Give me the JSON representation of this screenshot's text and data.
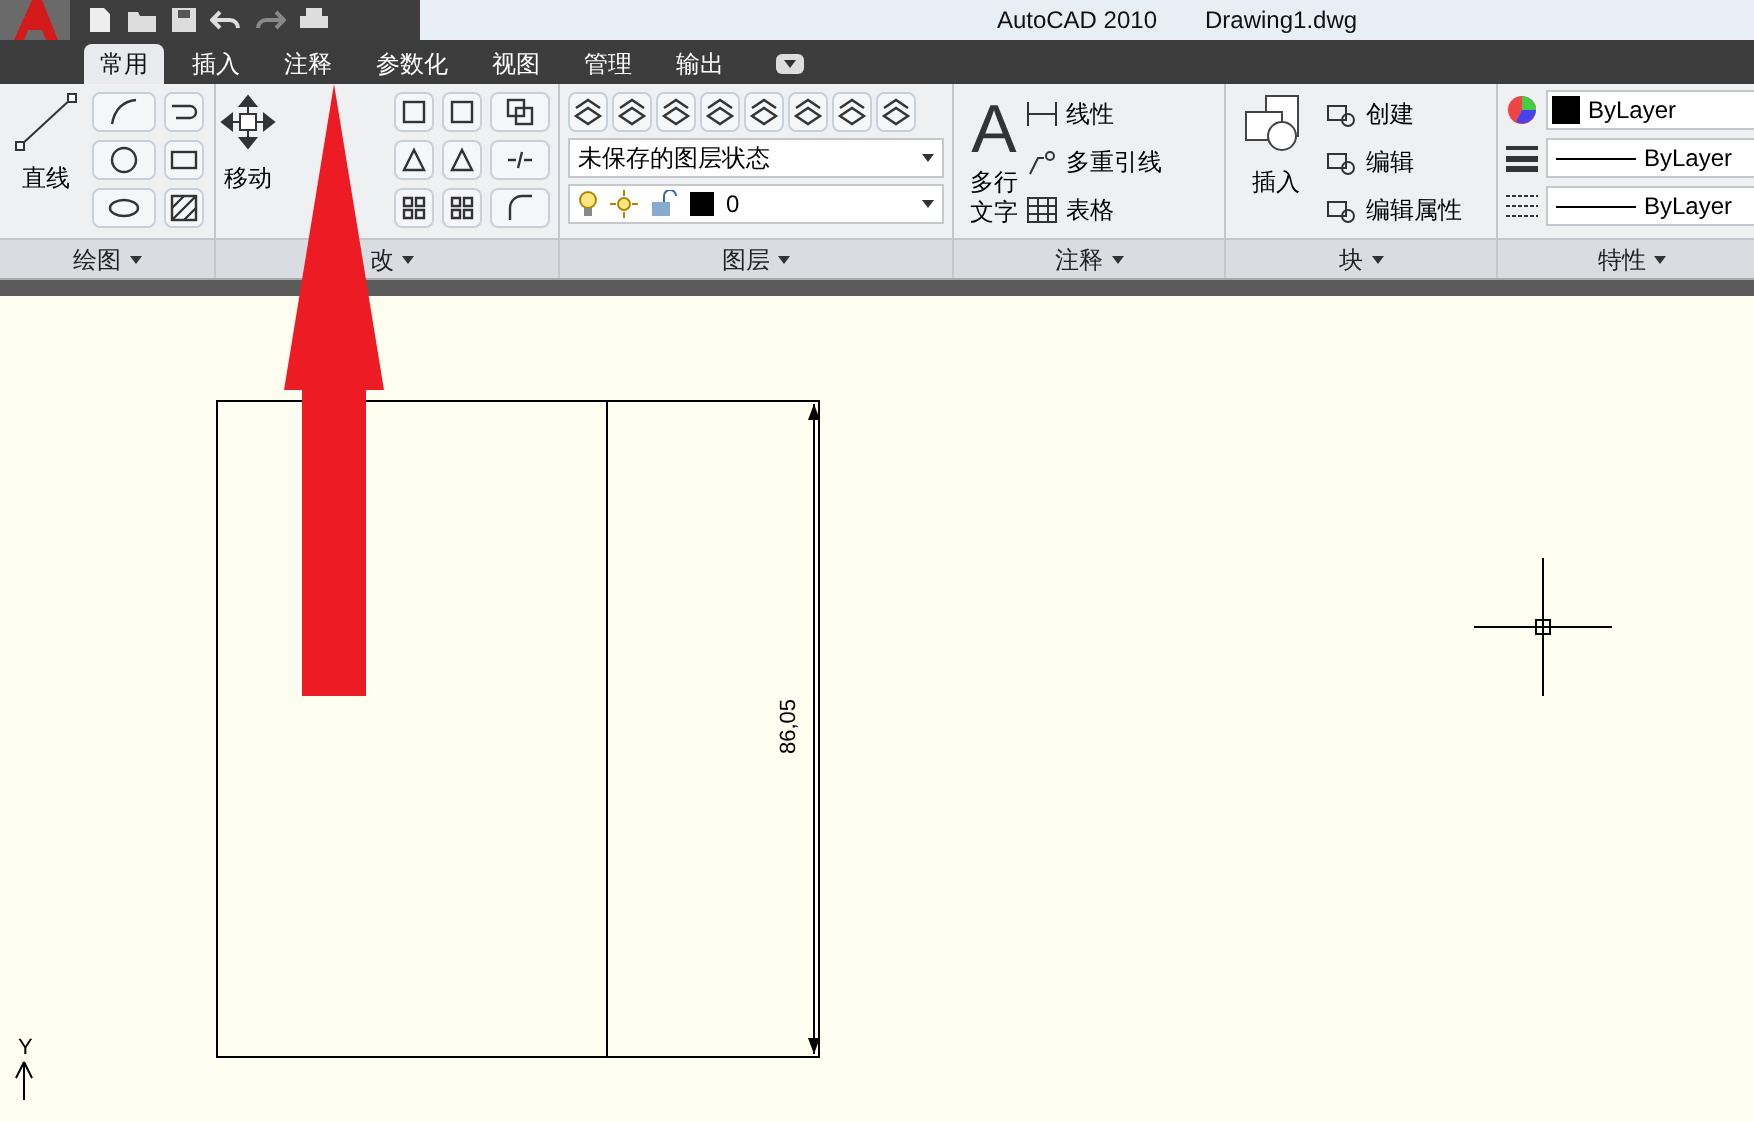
{
  "title_bar": {
    "app": "AutoCAD 2010",
    "document": "Drawing1.dwg"
  },
  "tabs": [
    {
      "label": "常用",
      "selected": true
    },
    {
      "label": "插入",
      "selected": false
    },
    {
      "label": "注释",
      "selected": false
    },
    {
      "label": "参数化",
      "selected": false
    },
    {
      "label": "视图",
      "selected": false
    },
    {
      "label": "管理",
      "selected": false
    },
    {
      "label": "输出",
      "selected": false
    }
  ],
  "panels": {
    "draw": {
      "label": "绘图",
      "large_button": "直线"
    },
    "modify": {
      "label": "改",
      "large_button": "移动"
    },
    "layers": {
      "label": "图层",
      "layer_state": "未保存的图层状态",
      "current_layer": "0"
    },
    "annotation": {
      "label": "注释",
      "large_icon": "A",
      "large_button": [
        "多行",
        "文字"
      ],
      "items": [
        "线性",
        "多重引线",
        "表格"
      ]
    },
    "block": {
      "label": "块",
      "large_button": "插入",
      "items": [
        "创建",
        "编辑",
        "编辑属性"
      ]
    },
    "properties": {
      "label": "特性",
      "color_setting": "ByLayer",
      "lineweight": "ByLayer",
      "linetype": "ByLayer"
    }
  },
  "drawing": {
    "dimension": "86,05",
    "ucs_axis": "Y"
  }
}
